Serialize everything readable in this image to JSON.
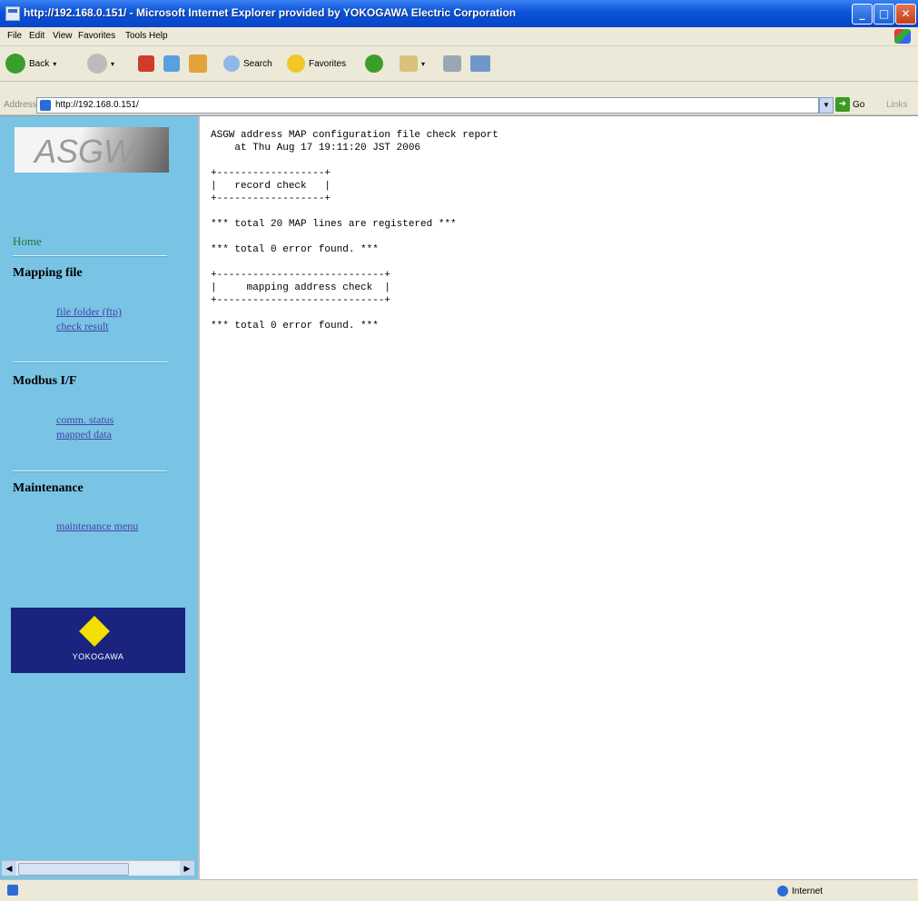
{
  "window": {
    "title": "http://192.168.0.151/ - Microsoft Internet Explorer provided by YOKOGAWA Electric Corporation"
  },
  "menu": {
    "items": [
      "File",
      "Edit",
      "View",
      "Favorites",
      "Tools",
      "Help"
    ]
  },
  "toolbar": {
    "back_label": "Back",
    "search_label": "Search",
    "favorites_label": "Favorites"
  },
  "address": {
    "label": "Address",
    "value": "http://192.168.0.151/",
    "go_label": "Go",
    "links_label": "Links"
  },
  "sidebar": {
    "logo_text": "ASGW",
    "home": "Home",
    "sections": [
      {
        "title": "Mapping file",
        "links": [
          "file folder (ftp)",
          "check result"
        ]
      },
      {
        "title": "Modbus I/F",
        "links": [
          "comm. status",
          "mapped data"
        ]
      },
      {
        "title": "Maintenance",
        "links": [
          "maintenance menu"
        ]
      }
    ],
    "brand_text": "YOKOGAWA"
  },
  "report": {
    "text": "ASGW address MAP configuration file check report\n    at Thu Aug 17 19:11:20 JST 2006\n\n+------------------+\n|   record check   |\n+------------------+\n\n*** total 20 MAP lines are registered ***\n\n*** total 0 error found. ***\n\n+----------------------------+\n|     mapping address check  |\n+----------------------------+\n\n*** total 0 error found. ***"
  },
  "status": {
    "zone": "Internet"
  }
}
